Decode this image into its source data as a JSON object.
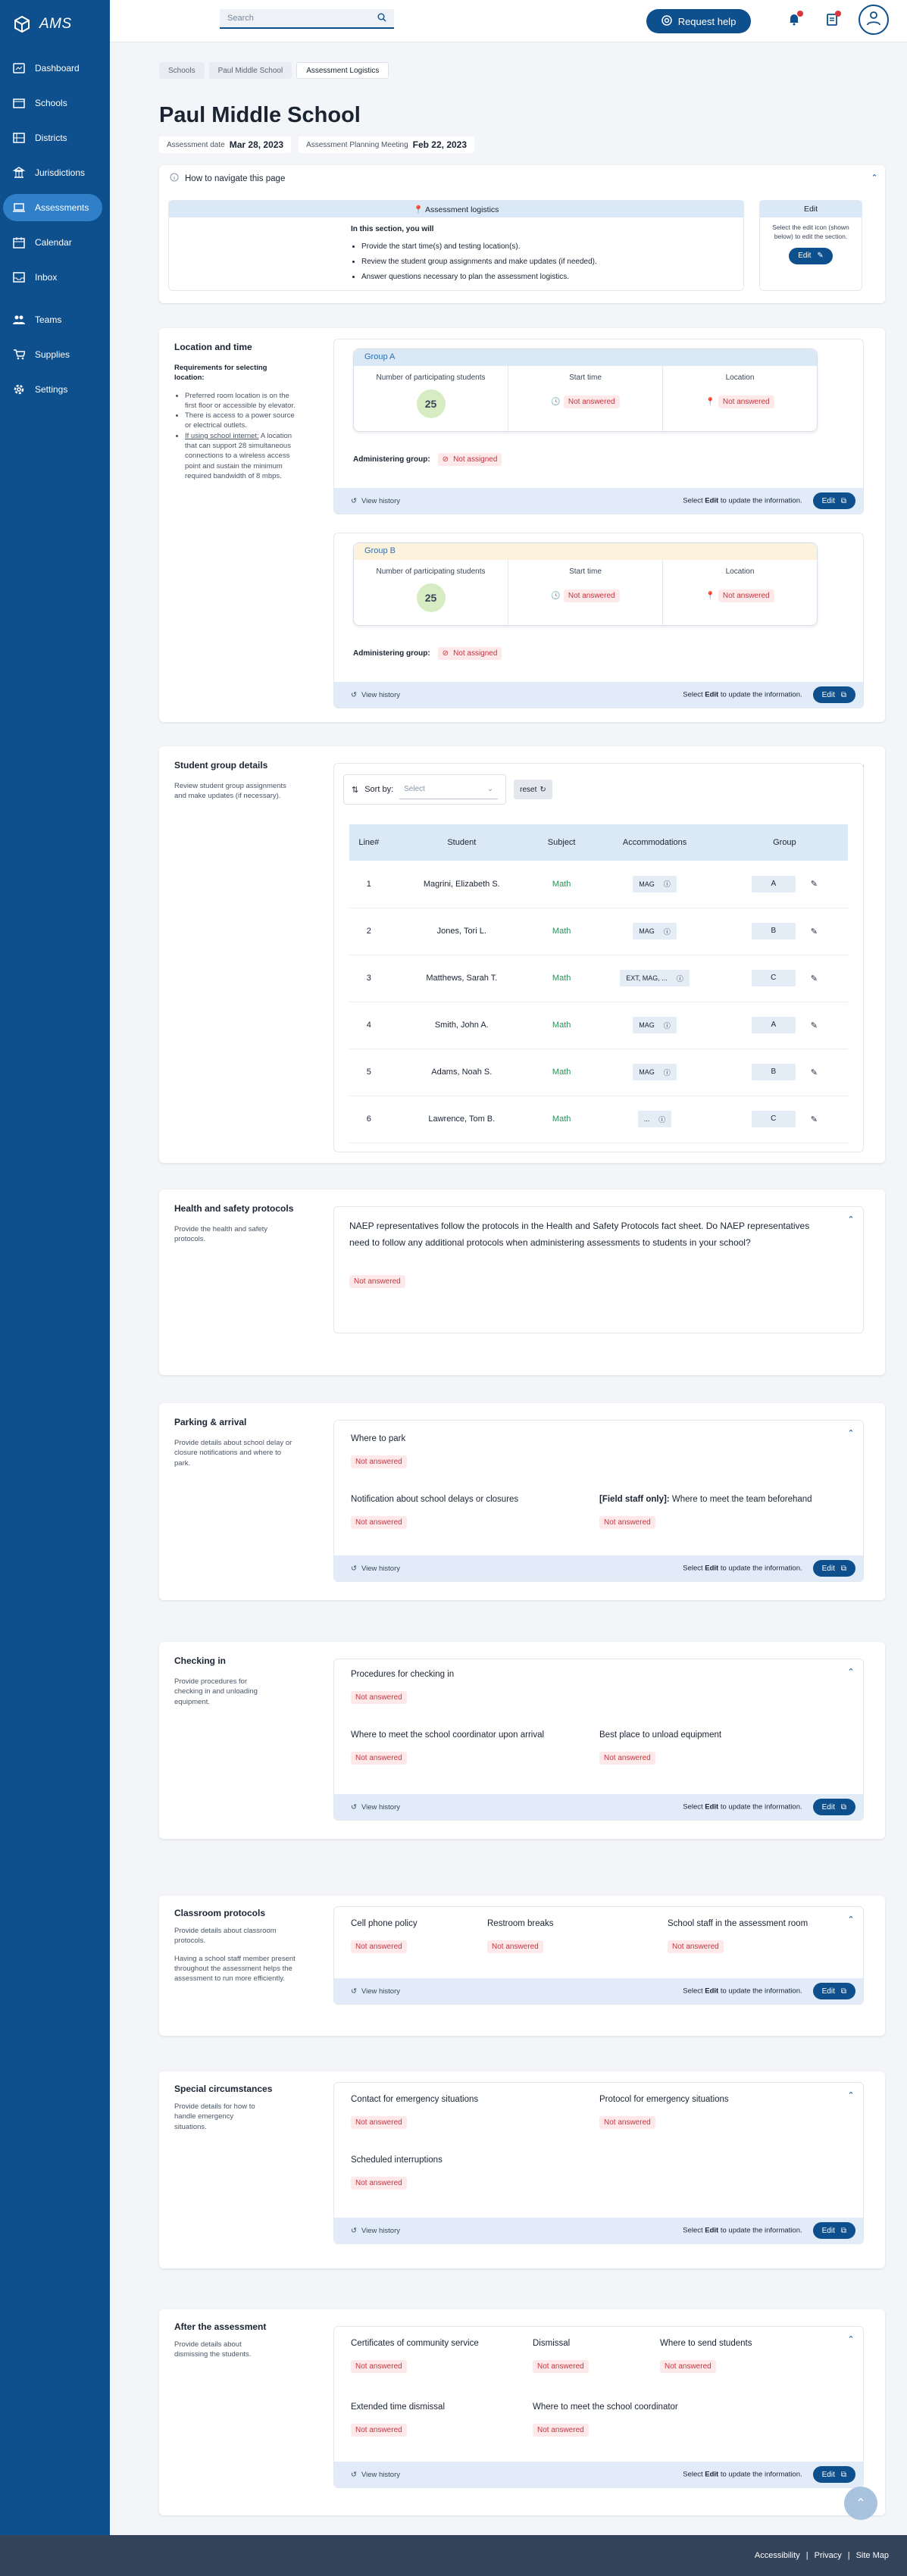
{
  "app": {
    "name": "AMS"
  },
  "nav": [
    {
      "label": "Dashboard",
      "icon": "dashboard-icon"
    },
    {
      "label": "Schools",
      "icon": "school-icon"
    },
    {
      "label": "Districts",
      "icon": "district-icon"
    },
    {
      "label": "Jurisdictions",
      "icon": "jurisdiction-icon"
    },
    {
      "label": "Assessments",
      "icon": "laptop-icon"
    },
    {
      "label": "Calendar",
      "icon": "calendar-icon"
    },
    {
      "label": "Inbox",
      "icon": "inbox-icon"
    },
    {
      "label": "Teams",
      "icon": "team-icon"
    },
    {
      "label": "Supplies",
      "icon": "cart-icon"
    },
    {
      "label": "Settings",
      "icon": "gear-icon"
    }
  ],
  "topbar": {
    "search_placeholder": "Search",
    "request_help": "Request help"
  },
  "breadcrumb": [
    "Schools",
    "Paul Middle School",
    "Assessment Logistics"
  ],
  "page": {
    "title": "Paul Middle School",
    "assessment_date_label": "Assessment date",
    "assessment_date": "Mar 28, 2023",
    "planning_label": "Assessment Planning Meeting",
    "planning_date": "Feb 22, 2023"
  },
  "howto": {
    "title": "How to navigate this page",
    "banner": "Assessment logistics",
    "intro": "In this section, you will",
    "items": [
      "Provide the start time(s) and testing location(s).",
      "Review the student group assignments and make updates (if needed).",
      "Answer questions necessary to plan the assessment logistics."
    ],
    "edit_title": "Edit",
    "edit_desc": "Select the edit icon (shown below) to edit the section.",
    "edit_btn": "Edit"
  },
  "common": {
    "view_history": "View history",
    "update_hint_pre": "Select ",
    "update_hint_bold": "Edit",
    "update_hint_post": " to update the information.",
    "edit": "Edit",
    "not_answered": "Not answered",
    "not_assigned": "Not assigned"
  },
  "location": {
    "title": "Location and time",
    "req_title": "Requirements for selecting location:",
    "reqs": [
      "Preferred room location is on the first floor or accessible by elevator.",
      "There is access to a power source or electrical outlets.",
      "A location that can support 28 simultaneous connections to a wireless access point and sustain the minimum required bandwidth of 8 mbps."
    ],
    "req_link": "If using school internet:",
    "groups": [
      {
        "name": "Group A",
        "students": "25",
        "students_label": "Number of participating students",
        "start_label": "Start time",
        "loc_label": "Location",
        "admin_label": "Administering group:"
      },
      {
        "name": "Group B",
        "students": "25",
        "students_label": "Number of participating students",
        "start_label": "Start time",
        "loc_label": "Location",
        "admin_label": "Administering group:"
      }
    ]
  },
  "students": {
    "title": "Student group details",
    "desc": "Review student group assignments and make updates (if necessary).",
    "sort_label": "Sort by:",
    "sort_placeholder": "Select",
    "reset": "reset",
    "columns": [
      "Line#",
      "Student",
      "Subject",
      "Accommodations",
      "Group"
    ],
    "rows": [
      {
        "line": "1",
        "student": "Magrini, Elizabeth S.",
        "subject": "Math",
        "acc": "MAG",
        "group": "A"
      },
      {
        "line": "2",
        "student": "Jones, Tori L.",
        "subject": "Math",
        "acc": "MAG",
        "group": "B"
      },
      {
        "line": "3",
        "student": "Matthews, Sarah T.",
        "subject": "Math",
        "acc": "EXT, MAG, ...",
        "group": "C"
      },
      {
        "line": "4",
        "student": "Smith, John A.",
        "subject": "Math",
        "acc": "MAG",
        "group": "A"
      },
      {
        "line": "5",
        "student": "Adams, Noah S.",
        "subject": "Math",
        "acc": "MAG",
        "group": "B"
      },
      {
        "line": "6",
        "student": "Lawrence, Tom B.",
        "subject": "Math",
        "acc": "...",
        "group": "C"
      }
    ]
  },
  "health": {
    "title": "Health and safety protocols",
    "desc": "Provide the health and safety protocols.",
    "question": "NAEP representatives follow the protocols in the Health and Safety Protocols fact sheet. Do NAEP representatives need to follow any additional protocols when administering assessments to students in your school?"
  },
  "parking": {
    "title": "Parking & arrival",
    "desc": "Provide details about school delay or closure notifications and where to park.",
    "q1": "Where to park",
    "q2": "Notification about school delays or closures",
    "q3_bold": "[Field staff only]:",
    "q3": " Where to meet the team beforehand"
  },
  "checkin": {
    "title": "Checking in",
    "desc": "Provide procedures for checking in and unloading equipment.",
    "q1": "Procedures for checking in",
    "q2": "Where to meet the school coordinator upon arrival",
    "q3": "Best place to unload equipment"
  },
  "classroom": {
    "title": "Classroom protocols",
    "desc": "Provide details about classroom protocols.",
    "desc2": "Having a school staff member present throughout the assessment helps the assessment to run more efficiently.",
    "q1": "Cell phone policy",
    "q2": "Restroom breaks",
    "q3": "School staff in the assessment room"
  },
  "special": {
    "title": "Special circumstances",
    "desc": "Provide details for how to handle emergency situations.",
    "q1": "Contact for emergency situations",
    "q2": "Protocol for emergency situations",
    "q3": "Scheduled interruptions"
  },
  "after": {
    "title": "After the assessment",
    "desc": "Provide details about dismissing the students.",
    "q1": "Certificates of community service",
    "q2": "Dismissal",
    "q3": "Where to send students",
    "q4": "Extended time dismissal",
    "q5": "Where to meet the school coordinator"
  },
  "footer": {
    "links": [
      "Accessibility",
      "Privacy",
      "Site Map"
    ]
  },
  "colors": {
    "brand": "#0e4f8d",
    "active": "#2f7fc9",
    "danger": "#c4363e",
    "math": "#2f8f5a"
  }
}
